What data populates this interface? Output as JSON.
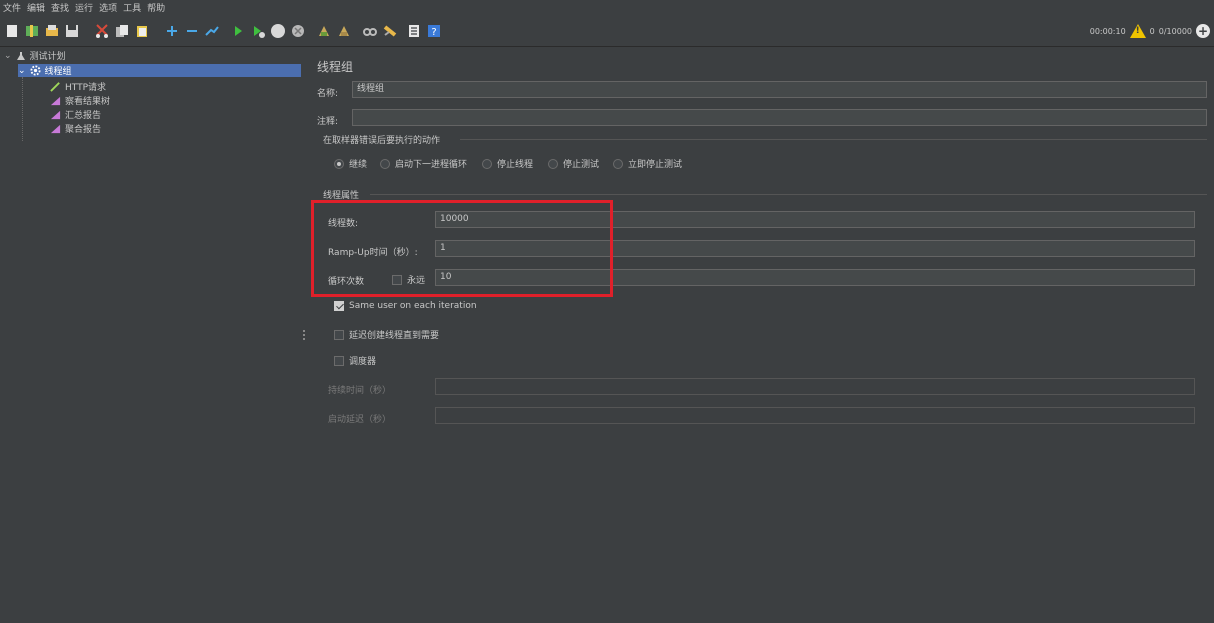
{
  "menu": [
    "文件",
    "编辑",
    "查找",
    "运行",
    "选项",
    "工具",
    "帮助"
  ],
  "toolbar": {
    "icons": [
      "new-icon",
      "templates-icon",
      "open-icon",
      "save-icon",
      "cut-icon",
      "copy-icon",
      "paste-icon",
      "expand-icon",
      "collapse-icon",
      "toggle-icon",
      "start-icon",
      "start-no-pause-icon",
      "stop-icon",
      "shutdown-icon",
      "clear-icon",
      "clear-all-icon",
      "search-icon",
      "reset-search-icon",
      "function-helper-icon",
      "help-icon"
    ],
    "timer": "00:00:10",
    "warn_count": "0",
    "threads": "0/10000"
  },
  "tree": {
    "root": "测试计划",
    "thread_group": "线程组",
    "children": [
      "HTTP请求",
      "察看结果树",
      "汇总报告",
      "聚合报告"
    ]
  },
  "panel": {
    "title": "线程组",
    "name_label": "名称:",
    "name_value": "线程组",
    "comment_label": "注释:",
    "comment_value": "",
    "error_section": "在取样器错误后要执行的动作",
    "error_options": [
      "继续",
      "启动下一进程循环",
      "停止线程",
      "停止测试",
      "立即停止测试"
    ],
    "selected_option": "继续",
    "props_section": "线程属性",
    "threads_label": "线程数:",
    "threads_value": "10000",
    "rampup_label": "Ramp-Up时间（秒）:",
    "rampup_value": "1",
    "loop_label": "循环次数",
    "forever_label": "永远",
    "loop_value": "10",
    "same_user_label": "Same user on each iteration",
    "delay_label": "延迟创建线程直到需要",
    "scheduler_label": "调度器",
    "duration_label": "持续时间（秒）",
    "startup_delay_label": "启动延迟（秒）"
  },
  "colors": {
    "background": "#3c3f41",
    "selection": "#4b6eaf",
    "highlight_box": "#e0202a"
  }
}
